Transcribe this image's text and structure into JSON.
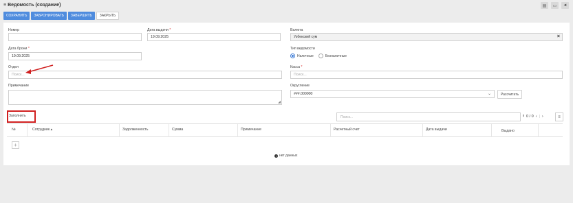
{
  "header": {
    "title": "Ведомость (создание)",
    "icons": [
      "document-icon",
      "card-icon",
      "megaphone-icon"
    ]
  },
  "toolbar": {
    "save": "СОХРАНИТЬ",
    "reserve": "ЗАБРОНИРОВАТЬ",
    "finish": "ЗАВЕРШИТЬ",
    "close": "ЗАКРЫТЬ"
  },
  "form": {
    "number_label": "Номер",
    "number_value": "",
    "issue_date_label": "Дата выдачи",
    "issue_date_value": "19.09.2025",
    "currency_label": "Валюта",
    "currency_value": "Узбекский сум",
    "booking_date_label": "Дата брони",
    "booking_date_value": "19.09.2025",
    "statement_type_label": "Тип ведомости",
    "type_cash": "Наличные",
    "type_noncash": "Безналичные",
    "department_label": "Отдел",
    "department_placeholder": "Поиск...",
    "cashbox_label": "Касса",
    "cashbox_placeholder": "Поиск...",
    "note_label": "Примечание",
    "rounding_label": "Округление",
    "rounding_value": "###.000000",
    "calculate": "Рассчитать",
    "required_mark": "*"
  },
  "grid": {
    "fill_button": "Заполнить",
    "search_placeholder": "Поиск...",
    "pager_text": "0 / 0",
    "columns": [
      "№",
      "Сотрудник",
      "Задолженность",
      "Сумма",
      "Примечание",
      "Расчетный счет",
      "Дата выдачи",
      "Выдано"
    ],
    "empty_text": "нет данных"
  }
}
